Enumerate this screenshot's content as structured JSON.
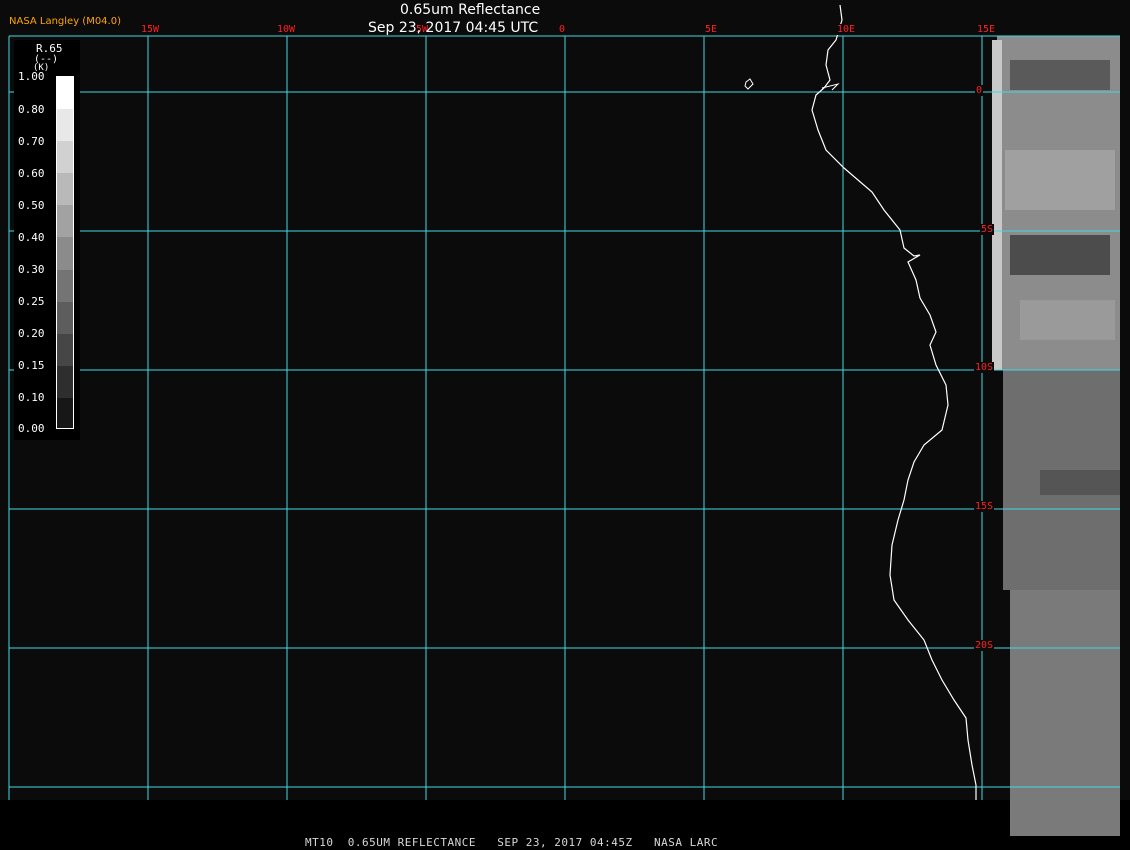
{
  "header": {
    "title": "0.65um Reflectance",
    "subtitle": "Sep 23, 2017 04:45 UTC",
    "source": "NASA Langley (M04.0)"
  },
  "footer": {
    "text": "MT10  0.65UM REFLECTANCE   SEP 23, 2017 04:45Z   NASA LARC"
  },
  "map": {
    "colors": {
      "background": "#0b0b0b",
      "grid": "#40d8e0",
      "coastline": "#ffffff",
      "labels": "#ff2020"
    },
    "longitude_labels": [
      "15W",
      "10W",
      "5W",
      "0",
      "5E",
      "10E",
      "15E"
    ],
    "latitude_labels": [
      "0",
      "5S",
      "10S",
      "15S",
      "20S"
    ]
  },
  "legend": {
    "variable": "R.65",
    "unit": "(--)",
    "unit_prefix": "(K)",
    "ticks": [
      "1.00",
      "0.80",
      "0.70",
      "0.60",
      "0.50",
      "0.40",
      "0.30",
      "0.25",
      "0.20",
      "0.15",
      "0.10",
      "0.00"
    ]
  }
}
